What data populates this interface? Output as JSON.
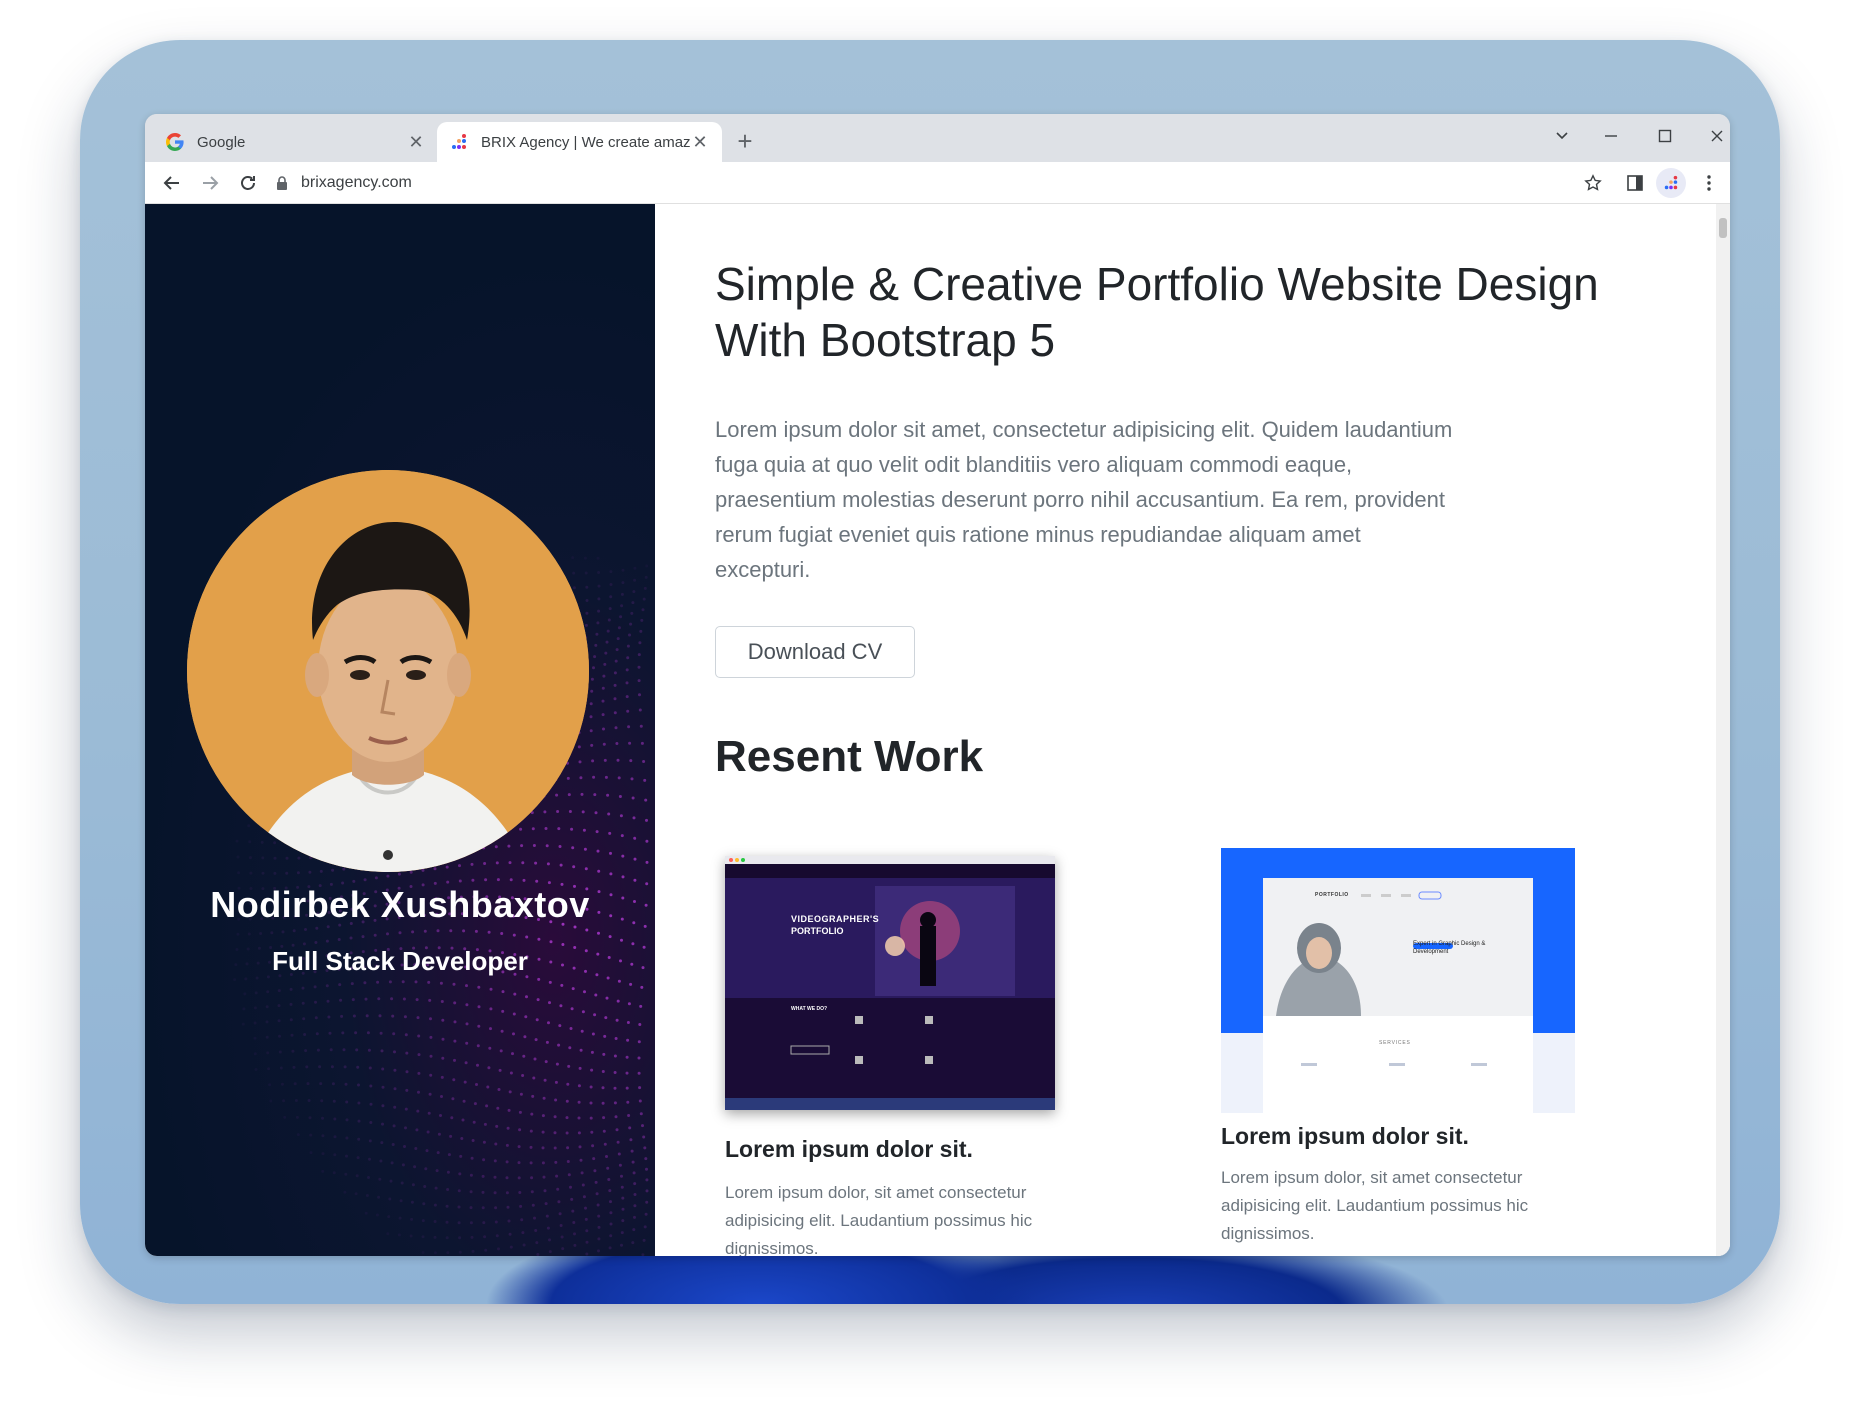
{
  "browser": {
    "tabs": [
      {
        "title": "Google",
        "favicon": "google-g-icon"
      },
      {
        "title": "BRIX Agency | We create amazi",
        "favicon": "brix-logo-icon"
      }
    ],
    "new_tab_label": "+",
    "url": "brixagency.com"
  },
  "profile": {
    "name": "Nodirbek Xushbaxtov",
    "role": "Full Stack Developer"
  },
  "main": {
    "headline": "Simple & Creative Portfolio Website Design With Bootstrap 5",
    "lede": "Lorem ipsum dolor sit amet, consectetur adipisicing elit. Quidem laudantium fuga quia at quo velit odit blanditiis vero aliquam commodi eaque, praesentium molestias deserunt porro nihil accusantium. Ea rem, provident rerum fugiat eveniet quis ratione minus repudiandae aliquam amet excepturi.",
    "download_label": "Download CV",
    "section_title": "Resent Work"
  },
  "work": [
    {
      "title": "Lorem ipsum dolor sit.",
      "text": "Lorem ipsum dolor, sit amet consectetur adipisicing elit. Laudantium possimus hic dignissimos.",
      "thumb": {
        "hero_line1": "VIDEOGRAPHER'S",
        "hero_line2": "PORTFOLIO",
        "section": "WHAT WE DO?"
      }
    },
    {
      "title": "Lorem ipsum dolor sit.",
      "text": "Lorem ipsum dolor, sit amet consectetur adipisicing elit. Laudantium possimus hic dignissimos.",
      "thumb": {
        "brand": "PORTFOLIO",
        "tagline": "Expert in Graphic Design & Development",
        "section": "SERVICES"
      }
    }
  ],
  "colors": {
    "sidebar": "#06142a",
    "avatar_bg": "#e2a04a",
    "accent_blue": "#1766ff",
    "dots": "#b23ad6"
  }
}
